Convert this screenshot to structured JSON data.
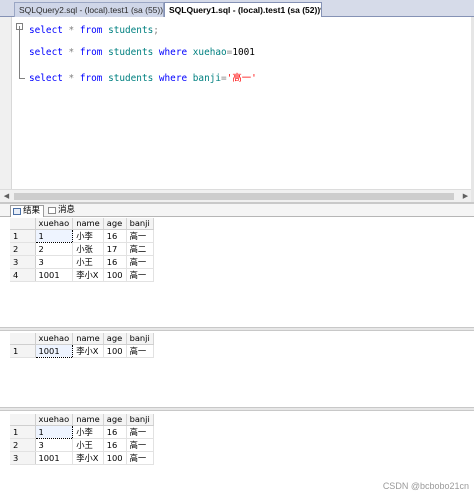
{
  "tabs": [
    {
      "label": "SQLQuery2.sql - (local).test1 (sa (55))",
      "active": false
    },
    {
      "label": "SQLQuery1.sql - (local).test1 (sa (52))*",
      "active": true
    }
  ],
  "editor": {
    "lines": [
      {
        "kw1": "select",
        "star": "*",
        "kw2": "from",
        "table": "students",
        "end": ";"
      },
      {
        "kw1": "select",
        "star": "*",
        "kw2": "from",
        "table": "students",
        "kw3": "where",
        "col": "xuehao",
        "op": "=",
        "val": "1001"
      },
      {
        "kw1": "select",
        "star": "*",
        "kw2": "from",
        "table": "students",
        "kw3": "where",
        "col": "banji",
        "op": "=",
        "val": "'高一'"
      }
    ]
  },
  "results_tabs": {
    "results": "结果",
    "messages": "消息"
  },
  "columns": [
    "xuehao",
    "name",
    "age",
    "banji"
  ],
  "results": [
    {
      "rows": [
        {
          "n": "1",
          "xuehao": "1",
          "name": "小李",
          "age": "16",
          "banji": "高一"
        },
        {
          "n": "2",
          "xuehao": "2",
          "name": "小张",
          "age": "17",
          "banji": "高二"
        },
        {
          "n": "3",
          "xuehao": "3",
          "name": "小王",
          "age": "16",
          "banji": "高一"
        },
        {
          "n": "4",
          "xuehao": "1001",
          "name": "李小X",
          "age": "100",
          "banji": "高一"
        }
      ]
    },
    {
      "rows": [
        {
          "n": "1",
          "xuehao": "1001",
          "name": "李小X",
          "age": "100",
          "banji": "高一"
        }
      ]
    },
    {
      "rows": [
        {
          "n": "1",
          "xuehao": "1",
          "name": "小李",
          "age": "16",
          "banji": "高一"
        },
        {
          "n": "2",
          "xuehao": "3",
          "name": "小王",
          "age": "16",
          "banji": "高一"
        },
        {
          "n": "3",
          "xuehao": "1001",
          "name": "李小X",
          "age": "100",
          "banji": "高一"
        }
      ]
    }
  ],
  "watermark": "CSDN @bcbobo21cn",
  "icons": {
    "results": "grid-icon",
    "messages": "message-icon"
  }
}
